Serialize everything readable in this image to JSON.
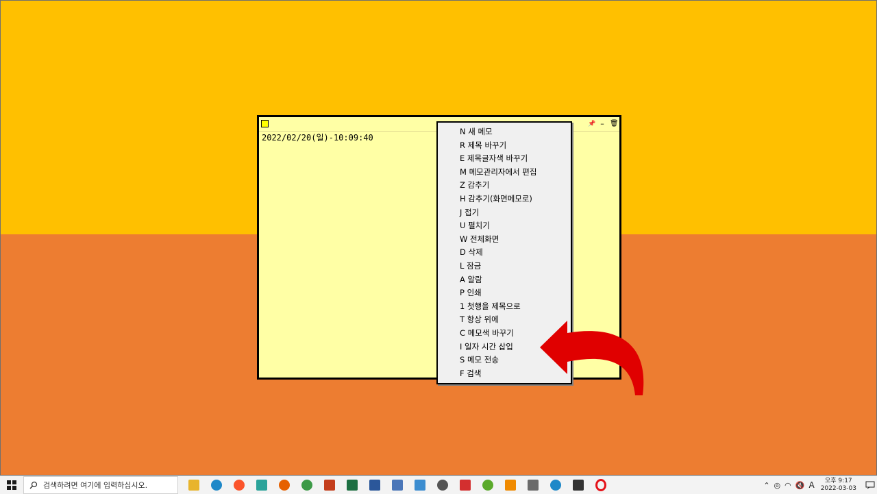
{
  "memo": {
    "datetime": "2022/02/20(일)-10:09:40",
    "controls": {
      "pin": "📌",
      "minimize": "–",
      "delete": "🗑"
    }
  },
  "context_menu": {
    "items": [
      "N 새 메모",
      "R 제목 바꾸기",
      "E 제목글자색 바꾸기",
      "M 메모관리자에서 편집",
      "Z 감추기",
      "H 감추기(화면메모로)",
      "J 접기",
      "U 펼치기",
      "W 전체화면",
      "D 삭제",
      "L 잠금",
      "A 알람",
      "P 인쇄",
      "1 첫행을 제목으로",
      "T 항상 위에",
      "C 메모색 바꾸기",
      "I 일자 시간 삽입",
      "S 메모 전송",
      "F 검색"
    ]
  },
  "taskbar": {
    "search_placeholder": "검색하려면 여기에 입력하십시오.",
    "apps": [
      "file-explorer",
      "edge",
      "brave",
      "app-green",
      "firefox",
      "chrome",
      "powerpoint",
      "excel",
      "word",
      "app-blue-1",
      "app-blue-2",
      "app-pen",
      "app-red",
      "app-green-2",
      "vlc",
      "calculator",
      "edge-alt",
      "app-notes",
      "opera"
    ],
    "tray": {
      "ime": "A",
      "time": "오후 9:17",
      "date": "2022-03-03"
    }
  },
  "colors": {
    "top_bg": "#FFC000",
    "bottom_bg": "#ED7D31",
    "memo_bg": "#FFFFA5",
    "arrow": "#E00000"
  }
}
